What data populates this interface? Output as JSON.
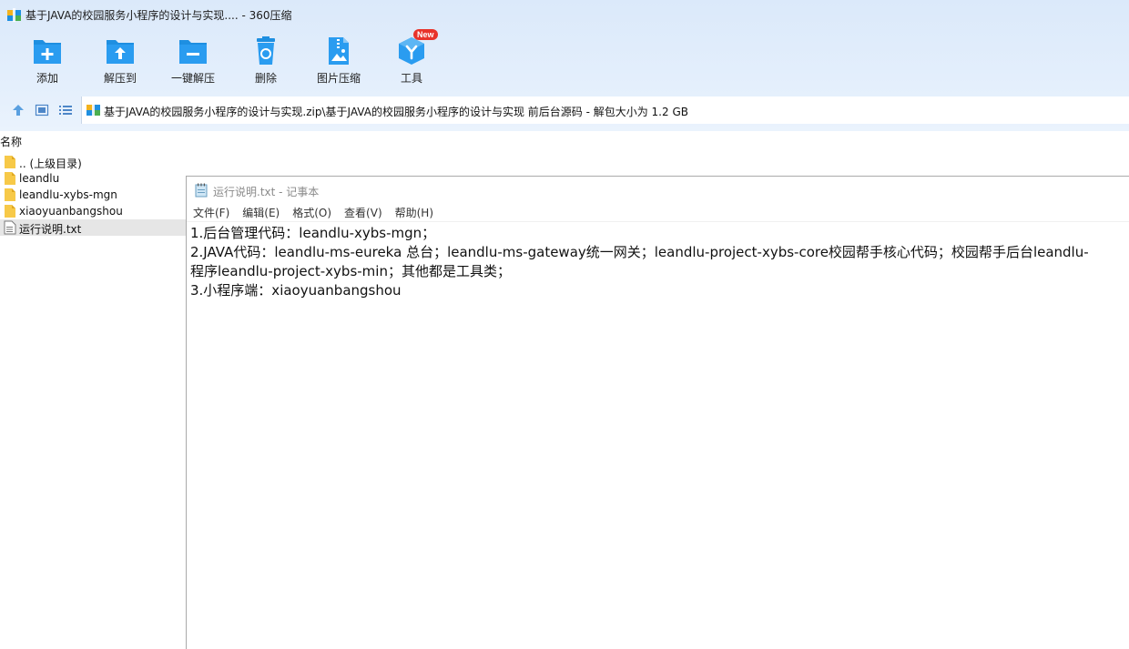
{
  "window": {
    "title": "基于JAVA的校园服务小程序的设计与实现.... - 360压缩"
  },
  "toolbar": {
    "items": [
      {
        "label": "添加",
        "icon": "add-icon"
      },
      {
        "label": "解压到",
        "icon": "extract-to-icon"
      },
      {
        "label": "一键解压",
        "icon": "one-click-extract-icon"
      },
      {
        "label": "删除",
        "icon": "delete-icon"
      },
      {
        "label": "图片压缩",
        "icon": "image-compress-icon"
      },
      {
        "label": "工具",
        "icon": "tools-icon",
        "badge": "New"
      }
    ]
  },
  "address": {
    "path": "基于JAVA的校园服务小程序的设计与实现.zip\\基于JAVA的校园服务小程序的设计与实现 前后台源码 - 解包大小为 1.2 GB"
  },
  "filelist": {
    "column_name": "名称",
    "items": [
      {
        "name": ".. (上级目录)",
        "type": "parent"
      },
      {
        "name": "leandlu",
        "type": "folder"
      },
      {
        "name": "leandlu-xybs-mgn",
        "type": "folder"
      },
      {
        "name": "xiaoyuanbangshou",
        "type": "folder"
      },
      {
        "name": "运行说明.txt",
        "type": "file",
        "selected": true
      }
    ]
  },
  "notepad": {
    "title": "运行说明.txt - 记事本",
    "menu": [
      "文件(F)",
      "编辑(E)",
      "格式(O)",
      "查看(V)",
      "帮助(H)"
    ],
    "lines": [
      "1.后台管理代码：leandlu-xybs-mgn；",
      "2.JAVA代码：leandlu-ms-eureka 总台；leandlu-ms-gateway统一网关；leandlu-project-xybs-core校园帮手核心代码；校园帮手后台leandlu-",
      "程序leandlu-project-xybs-min；其他都是工具类；",
      "3.小程序端：xiaoyuanbangshou"
    ]
  },
  "colors": {
    "accent_blue": "#1e8fe1",
    "badge_red": "#e8332a",
    "folder_yellow": "#f7c948",
    "selected_row": "#e6e6e6"
  }
}
